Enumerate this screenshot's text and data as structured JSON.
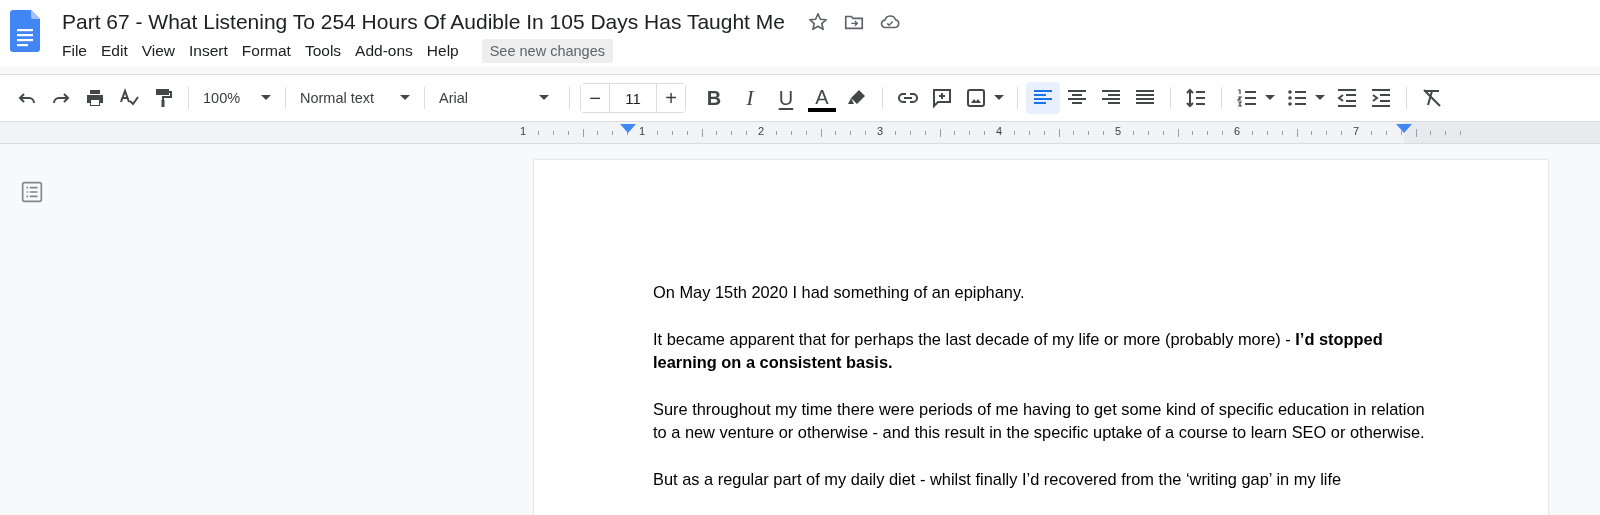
{
  "document": {
    "title": "Part 67 - What Listening To 254 Hours Of Audible In 105 Days Has Taught Me"
  },
  "menu": [
    "File",
    "Edit",
    "View",
    "Insert",
    "Format",
    "Tools",
    "Add-ons",
    "Help"
  ],
  "see_changes_button": "See new changes",
  "toolbar": {
    "zoom": "100%",
    "style": "Normal text",
    "font": "Arial",
    "size_minus": "−",
    "font_size": "11",
    "size_plus": "+",
    "format_buttons": [
      {
        "kind": "bold",
        "label": "B"
      },
      {
        "kind": "italic",
        "label": "I"
      },
      {
        "kind": "underline",
        "label": "U"
      },
      {
        "kind": "color",
        "label": "A"
      }
    ],
    "alignment": [
      {
        "selected": true
      },
      {
        "selected": false
      },
      {
        "selected": false
      },
      {
        "selected": false
      }
    ]
  },
  "ruler": {
    "labels": [
      "1",
      "1",
      "2",
      "3",
      "4",
      "5",
      "6",
      "7"
    ]
  },
  "paragraphs": [
    "On May 15th 2020 I had something of an epiphany.",
    "It became apparent that for perhaps the last decade of my life or more (probably more) - **I’d stopped learning on a consistent basis.**",
    "Sure throughout my time there were periods of me having to get some kind of specific education in relation to a new venture or otherwise - and this result in the specific uptake of a course to learn SEO or otherwise.",
    "But as a regular part of my daily diet - whilst finally I’d recovered from the ‘writing gap’ in my life"
  ]
}
